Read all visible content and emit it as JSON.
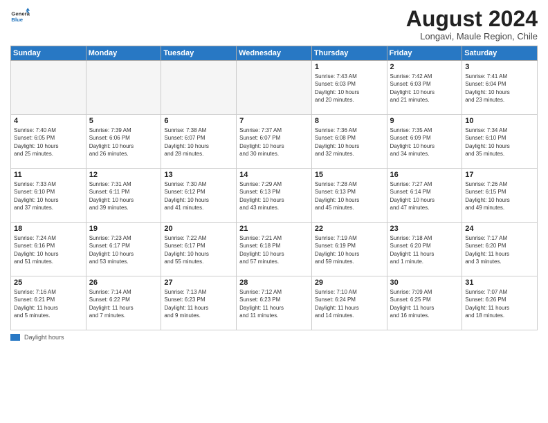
{
  "header": {
    "logo": {
      "general": "General",
      "blue": "Blue"
    },
    "title": "August 2024",
    "subtitle": "Longavi, Maule Region, Chile"
  },
  "days_of_week": [
    "Sunday",
    "Monday",
    "Tuesday",
    "Wednesday",
    "Thursday",
    "Friday",
    "Saturday"
  ],
  "legend": {
    "box_label": "Daylight hours"
  },
  "weeks": [
    [
      {
        "day": "",
        "info": ""
      },
      {
        "day": "",
        "info": ""
      },
      {
        "day": "",
        "info": ""
      },
      {
        "day": "",
        "info": ""
      },
      {
        "day": "1",
        "info": "Sunrise: 7:43 AM\nSunset: 6:03 PM\nDaylight: 10 hours\nand 20 minutes."
      },
      {
        "day": "2",
        "info": "Sunrise: 7:42 AM\nSunset: 6:03 PM\nDaylight: 10 hours\nand 21 minutes."
      },
      {
        "day": "3",
        "info": "Sunrise: 7:41 AM\nSunset: 6:04 PM\nDaylight: 10 hours\nand 23 minutes."
      }
    ],
    [
      {
        "day": "4",
        "info": "Sunrise: 7:40 AM\nSunset: 6:05 PM\nDaylight: 10 hours\nand 25 minutes."
      },
      {
        "day": "5",
        "info": "Sunrise: 7:39 AM\nSunset: 6:06 PM\nDaylight: 10 hours\nand 26 minutes."
      },
      {
        "day": "6",
        "info": "Sunrise: 7:38 AM\nSunset: 6:07 PM\nDaylight: 10 hours\nand 28 minutes."
      },
      {
        "day": "7",
        "info": "Sunrise: 7:37 AM\nSunset: 6:07 PM\nDaylight: 10 hours\nand 30 minutes."
      },
      {
        "day": "8",
        "info": "Sunrise: 7:36 AM\nSunset: 6:08 PM\nDaylight: 10 hours\nand 32 minutes."
      },
      {
        "day": "9",
        "info": "Sunrise: 7:35 AM\nSunset: 6:09 PM\nDaylight: 10 hours\nand 34 minutes."
      },
      {
        "day": "10",
        "info": "Sunrise: 7:34 AM\nSunset: 6:10 PM\nDaylight: 10 hours\nand 35 minutes."
      }
    ],
    [
      {
        "day": "11",
        "info": "Sunrise: 7:33 AM\nSunset: 6:10 PM\nDaylight: 10 hours\nand 37 minutes."
      },
      {
        "day": "12",
        "info": "Sunrise: 7:31 AM\nSunset: 6:11 PM\nDaylight: 10 hours\nand 39 minutes."
      },
      {
        "day": "13",
        "info": "Sunrise: 7:30 AM\nSunset: 6:12 PM\nDaylight: 10 hours\nand 41 minutes."
      },
      {
        "day": "14",
        "info": "Sunrise: 7:29 AM\nSunset: 6:13 PM\nDaylight: 10 hours\nand 43 minutes."
      },
      {
        "day": "15",
        "info": "Sunrise: 7:28 AM\nSunset: 6:13 PM\nDaylight: 10 hours\nand 45 minutes."
      },
      {
        "day": "16",
        "info": "Sunrise: 7:27 AM\nSunset: 6:14 PM\nDaylight: 10 hours\nand 47 minutes."
      },
      {
        "day": "17",
        "info": "Sunrise: 7:26 AM\nSunset: 6:15 PM\nDaylight: 10 hours\nand 49 minutes."
      }
    ],
    [
      {
        "day": "18",
        "info": "Sunrise: 7:24 AM\nSunset: 6:16 PM\nDaylight: 10 hours\nand 51 minutes."
      },
      {
        "day": "19",
        "info": "Sunrise: 7:23 AM\nSunset: 6:17 PM\nDaylight: 10 hours\nand 53 minutes."
      },
      {
        "day": "20",
        "info": "Sunrise: 7:22 AM\nSunset: 6:17 PM\nDaylight: 10 hours\nand 55 minutes."
      },
      {
        "day": "21",
        "info": "Sunrise: 7:21 AM\nSunset: 6:18 PM\nDaylight: 10 hours\nand 57 minutes."
      },
      {
        "day": "22",
        "info": "Sunrise: 7:19 AM\nSunset: 6:19 PM\nDaylight: 10 hours\nand 59 minutes."
      },
      {
        "day": "23",
        "info": "Sunrise: 7:18 AM\nSunset: 6:20 PM\nDaylight: 11 hours\nand 1 minute."
      },
      {
        "day": "24",
        "info": "Sunrise: 7:17 AM\nSunset: 6:20 PM\nDaylight: 11 hours\nand 3 minutes."
      }
    ],
    [
      {
        "day": "25",
        "info": "Sunrise: 7:16 AM\nSunset: 6:21 PM\nDaylight: 11 hours\nand 5 minutes."
      },
      {
        "day": "26",
        "info": "Sunrise: 7:14 AM\nSunset: 6:22 PM\nDaylight: 11 hours\nand 7 minutes."
      },
      {
        "day": "27",
        "info": "Sunrise: 7:13 AM\nSunset: 6:23 PM\nDaylight: 11 hours\nand 9 minutes."
      },
      {
        "day": "28",
        "info": "Sunrise: 7:12 AM\nSunset: 6:23 PM\nDaylight: 11 hours\nand 11 minutes."
      },
      {
        "day": "29",
        "info": "Sunrise: 7:10 AM\nSunset: 6:24 PM\nDaylight: 11 hours\nand 14 minutes."
      },
      {
        "day": "30",
        "info": "Sunrise: 7:09 AM\nSunset: 6:25 PM\nDaylight: 11 hours\nand 16 minutes."
      },
      {
        "day": "31",
        "info": "Sunrise: 7:07 AM\nSunset: 6:26 PM\nDaylight: 11 hours\nand 18 minutes."
      }
    ]
  ]
}
